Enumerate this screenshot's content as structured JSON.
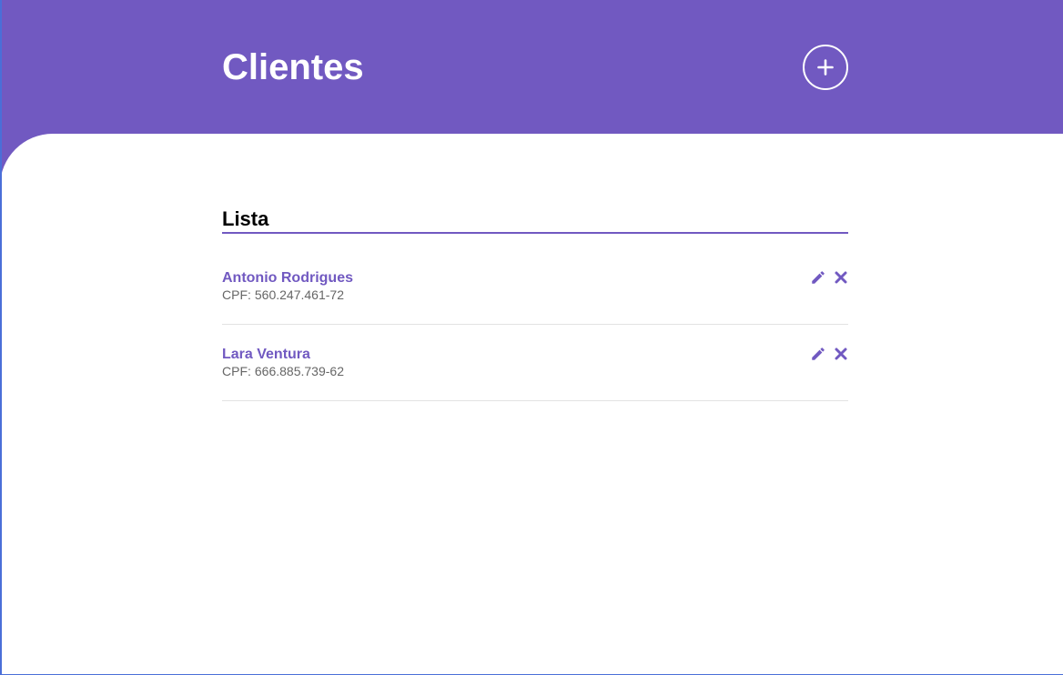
{
  "header": {
    "title": "Clientes",
    "add_icon": "plus-icon"
  },
  "colors": {
    "accent": "#7159c1",
    "header_text": "#ffffff",
    "secondary_text": "#666666",
    "divider": "#e2e2e2"
  },
  "list": {
    "title": "Lista",
    "cpf_label": "CPF:",
    "edit_icon": "pencil-icon",
    "delete_icon": "close-icon",
    "clients": [
      {
        "name": "Antonio Rodrigues",
        "cpf": "560.247.461-72"
      },
      {
        "name": "Lara Ventura",
        "cpf": "666.885.739-62"
      }
    ]
  }
}
